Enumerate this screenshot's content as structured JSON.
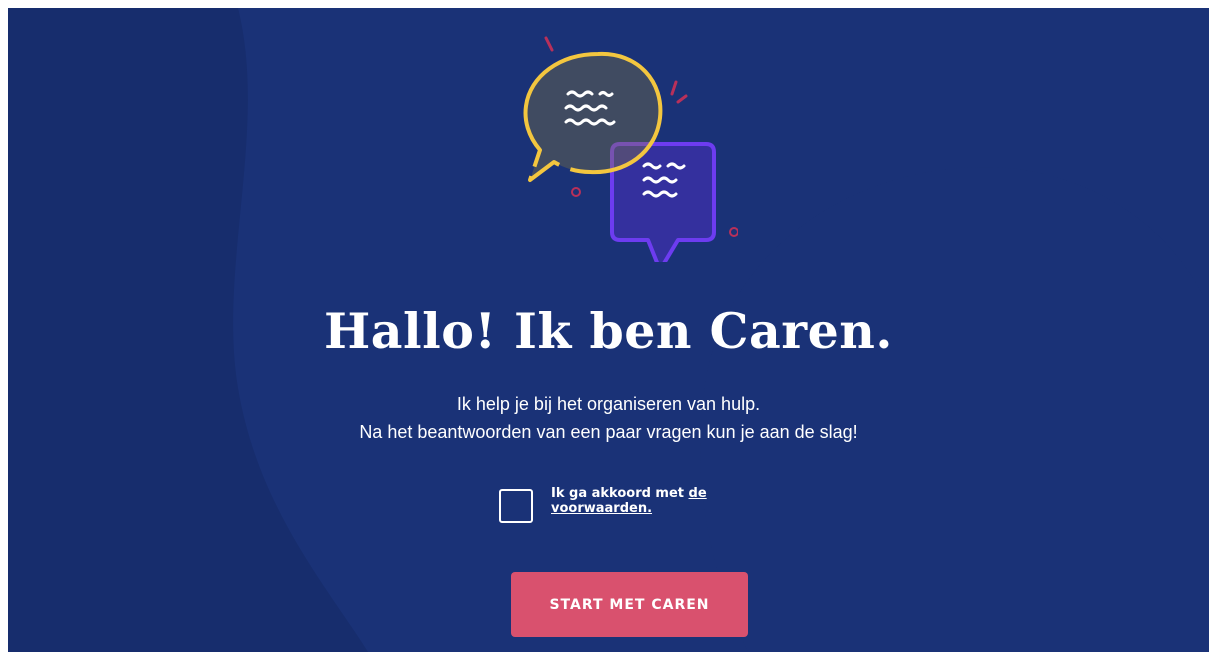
{
  "welcome": {
    "title": "Hallo! Ik ben Caren.",
    "subtitle_line1": "Ik help je bij het organiseren van hulp.",
    "subtitle_line2": "Na het beantwoorden van een paar vragen kun je aan de slag!"
  },
  "consent": {
    "checked": false,
    "text": "Ik ga akkoord met ",
    "link_text": "de voorwaarden."
  },
  "start_button": {
    "label": "START MET CAREN"
  },
  "colors": {
    "background": "#172d6d",
    "background_shape": "#1c3580",
    "button": "#d9516e",
    "bubble_yellow": "#f3c63f",
    "bubble_purple": "#6d3cf0",
    "text": "#ffffff"
  },
  "icons": {
    "illustration": "chat-bubbles-icon"
  }
}
